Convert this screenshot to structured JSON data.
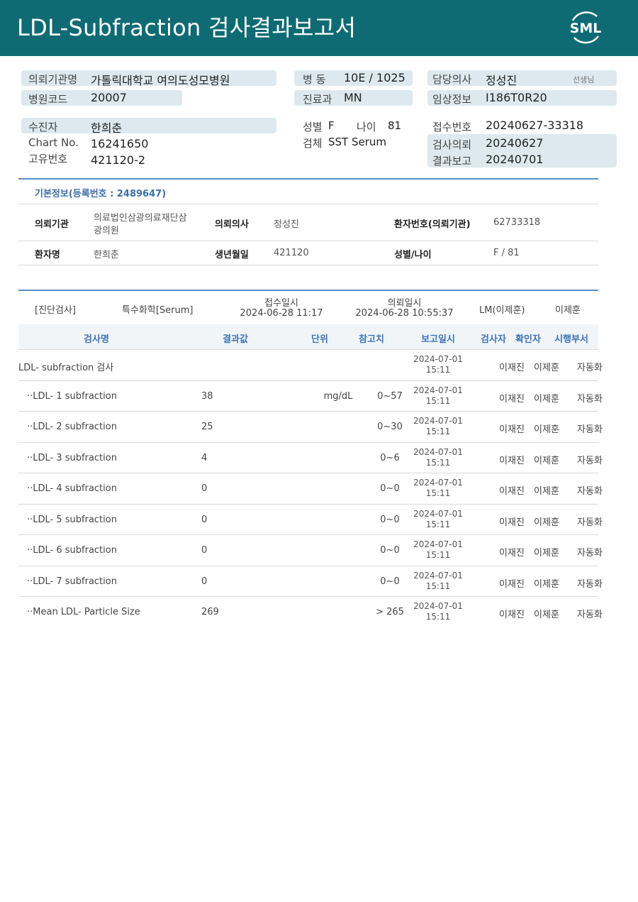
{
  "header": {
    "title": "LDL-Subfraction 검사결과보고서",
    "logo_text": "SML"
  },
  "info": {
    "institution_label": "의뢰기관명",
    "institution": "가톨릭대학교 여의도성모병원",
    "hospital_code_label": "병원코드",
    "hospital_code": "20007",
    "ward_label": "병  동",
    "ward": "10E / 1025",
    "department_label": "진료과",
    "department": "MN",
    "doctor_label": "담당의사",
    "doctor": "정성진",
    "doctor_suffix": "선생님",
    "clinical_label": "임상정보",
    "clinical": "I186T0R20",
    "patient_label": "수진자",
    "patient": "한희춘",
    "chart_label": "Chart No.",
    "chart_no": "16241650",
    "unique_label": "고유번호",
    "unique_no": "421120-2",
    "sex_label": "성별",
    "sex": "F",
    "age_label": "나이",
    "age": "81",
    "specimen_label": "검체",
    "specimen": "SST Serum",
    "receipt_label": "접수번호",
    "receipt_no": "20240627-33318",
    "request_label": "검사의뢰",
    "request_date": "20240627",
    "report_label": "결과보고",
    "report_date": "20240701"
  },
  "basic": {
    "title": "기본정보(등록번호 : 2489647)",
    "inst_label": "의뢰기관",
    "inst_line1": "의료법인삼광의료재단삼",
    "inst_line2": "광의원",
    "doc_label": "의뢰의사",
    "doc": "정성진",
    "pno_label": "환자번호(의뢰기관)",
    "pno": "62733318",
    "name_label": "환자명",
    "name": "한희춘",
    "birth_label": "생년월일",
    "birth": "421120",
    "sexage_label": "성별/나이",
    "sexage": "F / 81"
  },
  "test_meta": {
    "category": "[진단검사]",
    "section": "특수화학[Serum]",
    "receipt_label": "접수일시",
    "receipt_dt": "2024-06-28 11:17",
    "request_label": "의뢰일시",
    "request_dt": "2024-06-28 10:55:37",
    "lab": "LM(이제훈)",
    "person": "이제훈"
  },
  "columns": {
    "name": "검사명",
    "result": "결과값",
    "unit": "단위",
    "ref": "참고치",
    "report": "보고일시",
    "tester": "검사자",
    "verifier": "확인자",
    "dept": "시행부서"
  },
  "rows": [
    {
      "name": "LDL- subfraction 검사",
      "result": "",
      "unit": "",
      "ref": "",
      "date": "2024-07-01",
      "time": "15:11",
      "tester": "이재진",
      "verifier": "이제훈",
      "dept": "자동화"
    },
    {
      "name": "··LDL- 1 subfraction",
      "result": "38",
      "unit": "mg/dL",
      "ref": "0~57",
      "date": "2024-07-01",
      "time": "15:11",
      "tester": "이재진",
      "verifier": "이제훈",
      "dept": "자동화"
    },
    {
      "name": "··LDL- 2 subfraction",
      "result": "25",
      "unit": "",
      "ref": "0~30",
      "date": "2024-07-01",
      "time": "15:11",
      "tester": "이재진",
      "verifier": "이제훈",
      "dept": "자동화"
    },
    {
      "name": "··LDL- 3 subfraction",
      "result": "4",
      "unit": "",
      "ref": "0~6",
      "date": "2024-07-01",
      "time": "15:11",
      "tester": "이재진",
      "verifier": "이제훈",
      "dept": "자동화"
    },
    {
      "name": "··LDL- 4 subfraction",
      "result": "0",
      "unit": "",
      "ref": "0~0",
      "date": "2024-07-01",
      "time": "15:11",
      "tester": "이재진",
      "verifier": "이제훈",
      "dept": "자동화"
    },
    {
      "name": "··LDL- 5 subfraction",
      "result": "0",
      "unit": "",
      "ref": "0~0",
      "date": "2024-07-01",
      "time": "15:11",
      "tester": "이재진",
      "verifier": "이제훈",
      "dept": "자동화"
    },
    {
      "name": "··LDL- 6 subfraction",
      "result": "0",
      "unit": "",
      "ref": "0~0",
      "date": "2024-07-01",
      "time": "15:11",
      "tester": "이재진",
      "verifier": "이제훈",
      "dept": "자동화"
    },
    {
      "name": "··LDL- 7 subfraction",
      "result": "0",
      "unit": "",
      "ref": "0~0",
      "date": "2024-07-01",
      "time": "15:11",
      "tester": "이재진",
      "verifier": "이제훈",
      "dept": "자동화"
    },
    {
      "name": "··Mean LDL- Particle Size",
      "result": "269",
      "unit": "",
      "ref": "> 265",
      "date": "2024-07-01",
      "time": "15:11",
      "tester": "이재진",
      "verifier": "이제훈",
      "dept": "자동화"
    }
  ]
}
